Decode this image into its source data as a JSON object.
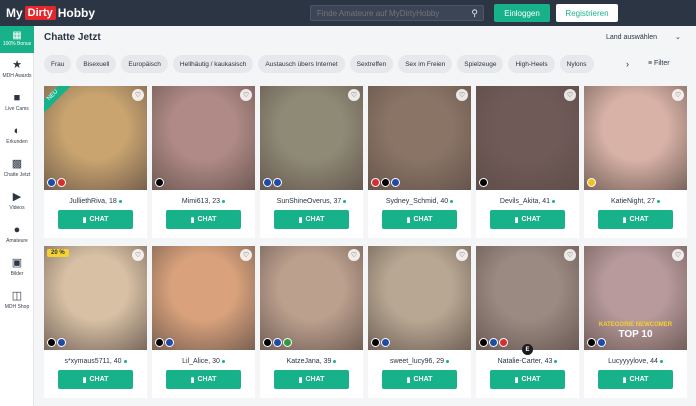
{
  "header": {
    "logo_left": "My",
    "logo_mid": "Dirty",
    "logo_right": "Hobby",
    "search_placeholder": "Finde Amateure auf MyDirtyHobby",
    "login_label": "Einloggen",
    "register_label": "Registrieren"
  },
  "sidebar": {
    "bonus_label": "100% Bonus",
    "items": [
      {
        "label": "MDH Awards",
        "icon": "star-icon"
      },
      {
        "label": "Live Cams",
        "icon": "camera-icon"
      },
      {
        "label": "Erkunden",
        "icon": "compass-icon"
      },
      {
        "label": "Chatte Jetzt",
        "icon": "chat-icon"
      },
      {
        "label": "Videos",
        "icon": "play-icon"
      },
      {
        "label": "Amateure",
        "icon": "user-icon"
      },
      {
        "label": "Bilder",
        "icon": "image-icon"
      },
      {
        "label": "MDH Shop",
        "icon": "shop-icon"
      }
    ]
  },
  "main": {
    "title": "Chatte Jetzt",
    "country_select": "Land auswählen",
    "filter_label": "Filter",
    "chips": [
      "Frau",
      "Bisexuell",
      "Europäisch",
      "Hellhäutig / kaukasisch",
      "Austausch übers Internet",
      "Sextreffen",
      "Sex im Freien",
      "Spielzeuge",
      "High-Heels",
      "Nylons"
    ],
    "chat_label": "CHAT",
    "new_badge": "NEU",
    "discount_badge": "20 %",
    "e_badge": "E",
    "overlay_top10_a": "KATEGORIE NEWCOMER",
    "overlay_top10_b": "TOP 10",
    "cards": [
      {
        "name": "JulliethRiva, 18",
        "color": "#c9a46f",
        "flags": [
          "#1f4aa8",
          "#d62f2f"
        ]
      },
      {
        "name": "Mimi613, 23",
        "color": "#b08a86",
        "flags": [
          "#000000"
        ]
      },
      {
        "name": "SunShineOverus, 37",
        "color": "#8f8a76",
        "flags": [
          "#1f4aa8",
          "#1f4aa8"
        ]
      },
      {
        "name": "Sydney_Schmid, 40",
        "color": "#8a7466",
        "flags": [
          "#d62f2f",
          "#000000",
          "#1f4aa8"
        ]
      },
      {
        "name": "Devils_Akita, 41",
        "color": "#6f5a58",
        "flags": [
          "#000000"
        ]
      },
      {
        "name": "KatieNight, 27",
        "color": "#d8b2a6",
        "flags": [
          "#f0c31a"
        ]
      },
      {
        "name": "s*xymaus5711, 40",
        "color": "#d7c0a4",
        "flags": [
          "#000000",
          "#1f4aa8"
        ]
      },
      {
        "name": "Lil_Alice, 30",
        "color": "#d9a27c",
        "flags": [
          "#000000",
          "#1f4aa8"
        ]
      },
      {
        "name": "KatzeJana, 39",
        "color": "#bca08e",
        "flags": [
          "#000000",
          "#1f4aa8",
          "#2e9b3c"
        ]
      },
      {
        "name": "sweet_lucy96, 29",
        "color": "#b8a893",
        "flags": [
          "#000000",
          "#1f4aa8"
        ]
      },
      {
        "name": "Natalie-Carter, 43",
        "color": "#9b8a82",
        "flags": [
          "#000000",
          "#1f4aa8",
          "#d62f2f"
        ]
      },
      {
        "name": "Lucyyyylove, 44",
        "color": "#b89a9c",
        "flags": [
          "#000000",
          "#1f4aa8"
        ]
      }
    ]
  }
}
